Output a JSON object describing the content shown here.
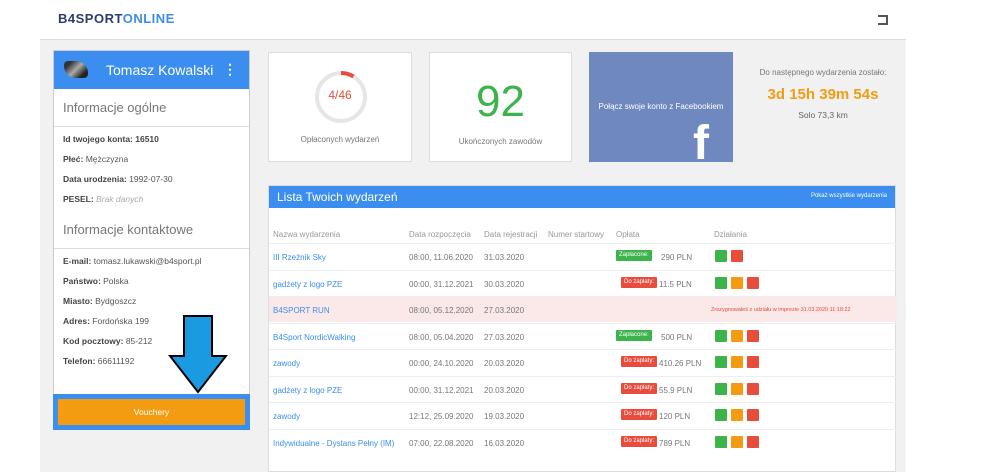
{
  "header": {
    "logo_a": "B4SP",
    "logo_o": "O",
    "logo_b": "RT",
    "logo_c": "ONLINE"
  },
  "profile": {
    "name": "Tomasz Kowalski",
    "general_title": "Informacje ogólne",
    "general": [
      {
        "label": "Id twojego konta: 16510",
        "value": ""
      },
      {
        "label": "Płeć:",
        "value": " Mężczyzna"
      },
      {
        "label": "Data urodzenia:",
        "value": " 1992-07-30"
      },
      {
        "label": "PESEL:",
        "value": " Brak danych",
        "muted": true
      }
    ],
    "contact_title": "Informacje kontaktowe",
    "contact": [
      {
        "label": "E-mail:",
        "value": " tomasz.lukawski@b4sport.pl"
      },
      {
        "label": "Państwo:",
        "value": " Polska"
      },
      {
        "label": "Miasto:",
        "value": " Bydgoszcz"
      },
      {
        "label": "Adres:",
        "value": " Fordońska 199"
      },
      {
        "label": "Kod pocztowy:",
        "value": " 85-212"
      },
      {
        "label": "Telefon:",
        "value": " 66611192"
      }
    ],
    "voucher_label": "Vouchery"
  },
  "stats": {
    "paid_events_text": "4/46",
    "paid_events_fraction": 0.087,
    "paid_events_label": "Opłaconych wydarzeń",
    "finished_value": "92",
    "finished_label": "Ukończonych zawodów",
    "facebook_text": "Połącz swoje konto z Facebookiem",
    "countdown_label": "Do następnego wydarzenia zostało:",
    "countdown_value": "3d 15h 39m 54s",
    "countdown_event": "Solo 73,3 km"
  },
  "events": {
    "title": "Lista Twoich wydarzeń",
    "show_all": "Pokaż wszystkie wydarzenia",
    "columns": [
      "Nazwa wydarzenia",
      "Data rozpoczęcia",
      "Data rejestracji",
      "Numer startowy",
      "Opłata",
      "Działania"
    ],
    "rows": [
      {
        "name": "III Rzeźnik Sky",
        "start": "08:00, 11.06.2020",
        "reg": "31.03.2020",
        "status": "Zapłacone:",
        "paid": true,
        "price": "290 PLN",
        "actions": [
          "g",
          "r"
        ]
      },
      {
        "name": "gadżety z logo PZE",
        "start": "00:00, 31.12.2021",
        "reg": "30.03.2020",
        "status": "Do zapłaty:",
        "paid": false,
        "price": "11.5 PLN",
        "actions": [
          "g",
          "o",
          "r"
        ]
      },
      {
        "name": "B4SPORT RUN",
        "start": "08:00, 05.12.2020",
        "reg": "27.03.2020",
        "note": "Zrezygnowałeś z udziału w imprezie 31.03.2020 11:18:22",
        "highlight": true
      },
      {
        "name": "B4Sport NordicWalking",
        "start": "08:00, 05.04.2020",
        "reg": "27.03.2020",
        "status": "Zapłacone:",
        "paid": true,
        "price": "500 PLN",
        "actions": [
          "g",
          "o",
          "r"
        ]
      },
      {
        "name": "zawody",
        "start": "00:00, 24.10.2020",
        "reg": "20.03.2020",
        "status": "Do zapłaty:",
        "paid": false,
        "price": "410.26 PLN",
        "actions": [
          "g",
          "o",
          "r"
        ]
      },
      {
        "name": "gadżety z logo PZE",
        "start": "00:00, 31.12.2021",
        "reg": "20.03.2020",
        "status": "Do zapłaty:",
        "paid": false,
        "price": "55.9 PLN",
        "actions": [
          "g",
          "o",
          "r"
        ]
      },
      {
        "name": "zawody",
        "start": "12:12, 25.09.2020",
        "reg": "19.03.2020",
        "status": "Do zapłaty:",
        "paid": false,
        "price": "120 PLN",
        "actions": [
          "g",
          "o",
          "r"
        ]
      },
      {
        "name": "Indywidualne - Dystans Pełny (IM)",
        "start": "07:00, 22.08.2020",
        "reg": "16.03.2020",
        "status": "Do zapłaty:",
        "paid": false,
        "price": "789 PLN",
        "actions": [
          "g",
          "o",
          "r"
        ]
      }
    ]
  },
  "colors": {
    "primary": "#3b8ef0",
    "orange": "#f39c12",
    "green": "#3cb44b",
    "red": "#e74c3c",
    "arrow": "#1a9ae0"
  }
}
